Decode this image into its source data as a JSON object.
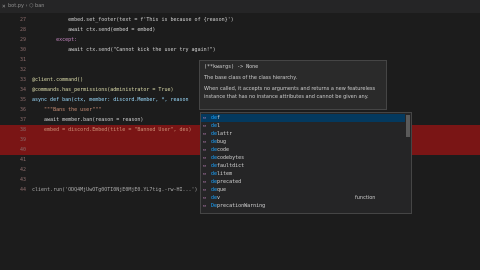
{
  "tab": {
    "close_glyph": "×",
    "breadcrumb": "bot.py › ⬡ ban"
  },
  "lines": [
    {
      "n": "27",
      "text": "            embed.set_footer(text = f'This is because of {reason}')",
      "cls": "c-def"
    },
    {
      "n": "28",
      "text": "            await ctx.send(embed = embed)",
      "cls": "c-def"
    },
    {
      "n": "29",
      "text": "        except:",
      "cls": "c-kw"
    },
    {
      "n": "30",
      "text": "            await ctx.send(\"Cannot kick the user try again!\")",
      "cls": "c-def"
    },
    {
      "n": "31",
      "text": "",
      "cls": "c-def"
    },
    {
      "n": "32",
      "text": "",
      "cls": "c-def"
    },
    {
      "n": "33",
      "text": "@client.command()",
      "cls": "c-dec"
    },
    {
      "n": "34",
      "text": "@commands.has_permissions(administrator = True)",
      "cls": "c-dec"
    },
    {
      "n": "35",
      "text": "async def ban(ctx, member: discord.Member, *, reason",
      "cls": "c-var"
    },
    {
      "n": "36",
      "text": "    \"\"\"Bans the user\"\"\"",
      "cls": "c-str"
    },
    {
      "n": "37",
      "text": "    await member.ban(reason = reason)",
      "cls": "c-def"
    },
    {
      "n": "38",
      "text": "    embed = discord.Embed(title = \"Banned User\", des)",
      "cls": "c-par",
      "hl": true
    },
    {
      "n": "39",
      "text": "",
      "cls": "c-def",
      "hl": true
    },
    {
      "n": "40",
      "text": "",
      "cls": "c-def",
      "hl": true
    },
    {
      "n": "41",
      "text": "",
      "cls": "c-def"
    },
    {
      "n": "42",
      "text": "",
      "cls": "c-def"
    },
    {
      "n": "43",
      "text": "",
      "cls": "c-def"
    },
    {
      "n": "44",
      "text": "client.run('ODQ4MjUwOTg0OTI0NjE0MjE0.YL7tig.-rw-HI...')",
      "cls": "c-com"
    }
  ],
  "hover": {
    "signature": "(**kwargs) -> None",
    "description": "The base class of the class hierarchy.",
    "text": "When called, it accepts no arguments and returns a new featureless instance that has no instance attributes and cannot be given any."
  },
  "suggest": {
    "items": [
      {
        "label": "def",
        "match": "de",
        "rest": "f",
        "selected": true
      },
      {
        "label": "del",
        "match": "de",
        "rest": "l"
      },
      {
        "label": "delattr",
        "match": "de",
        "rest": "lattr"
      },
      {
        "label": "debug",
        "match": "de",
        "rest": "bug"
      },
      {
        "label": "decode",
        "match": "de",
        "rest": "code"
      },
      {
        "label": "decodebytes",
        "match": "de",
        "rest": "codebytes"
      },
      {
        "label": "defaultdict",
        "match": "de",
        "rest": "faultdict"
      },
      {
        "label": "delitem",
        "match": "de",
        "rest": "litem"
      },
      {
        "label": "deprecated",
        "match": "de",
        "rest": "precated"
      },
      {
        "label": "deque",
        "match": "de",
        "rest": "que"
      },
      {
        "label": "dev",
        "match": "de",
        "rest": "v",
        "detail": "function"
      },
      {
        "label": "DeprecationWarning",
        "match": "De",
        "rest": "precationWarning"
      }
    ]
  }
}
